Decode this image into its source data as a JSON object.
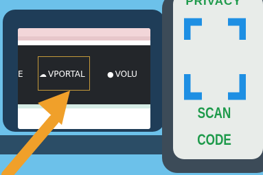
{
  "nav": {
    "prev_label": "E",
    "active_label": "VPORTAL",
    "next_label": "VOLU"
  },
  "panel": {
    "top_text": "PRIVACY",
    "line1": "SCAN",
    "line2": "CODE"
  },
  "colors": {
    "accent_green": "#1e9a4b",
    "scan_blue": "#1e8fe3",
    "arrow_orange": "#f0a02a"
  },
  "icons": {
    "cloud": "cloud-icon",
    "apple": "apple-icon",
    "arrow": "arrow-pointer-icon",
    "scan": "scan-frame-icon"
  }
}
